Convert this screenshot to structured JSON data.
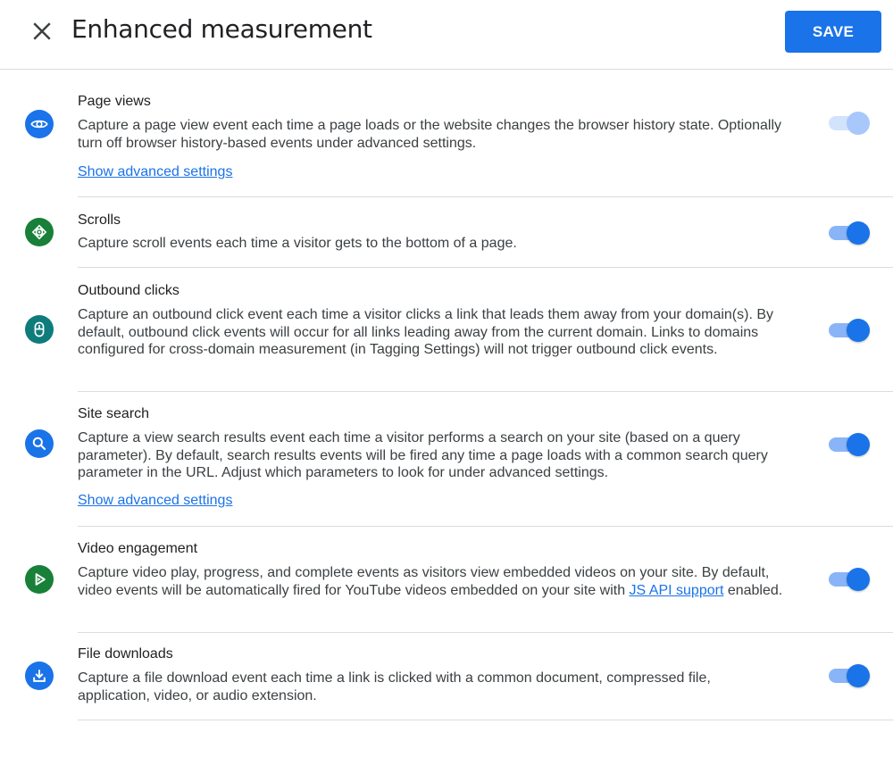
{
  "header": {
    "title": "Enhanced measurement",
    "close_icon": "close-icon",
    "save_label": "SAVE"
  },
  "colors": {
    "primary": "#1a73e8",
    "green": "#188038",
    "teal": "#0f7c7c",
    "divider": "#dadce0"
  },
  "settings": [
    {
      "name": "Page views",
      "icon": "eye-icon",
      "description": "Capture a page view event each time a page loads or the website changes the browser history state. Optionally turn off browser history-based events under advanced settings.",
      "advanced_link": "Show advanced settings",
      "enabled": true,
      "toggle_disabled": true
    },
    {
      "name": "Scrolls",
      "icon": "scroll-icon",
      "description": "Capture scroll events each time a visitor gets to the bottom of a page.",
      "enabled": true,
      "toggle_disabled": false
    },
    {
      "name": "Outbound clicks",
      "icon": "mouse-icon",
      "description": "Capture an outbound click event each time a visitor clicks a link that leads them away from your domain(s). By default, outbound click events will occur for all links leading away from the current domain. Links to domains configured for cross-domain measurement (in Tagging Settings) will not trigger outbound click events.",
      "enabled": true,
      "toggle_disabled": false
    },
    {
      "name": "Site search",
      "icon": "search-icon",
      "description": "Capture a view search results event each time a visitor performs a search on your site (based on a query parameter). By default, search results events will be fired any time a page loads with a common search query parameter in the URL. Adjust which parameters to look for under advanced settings.",
      "advanced_link": "Show advanced settings",
      "enabled": true,
      "toggle_disabled": false
    },
    {
      "name": "Video engagement",
      "icon": "play-icon",
      "description_before": "Capture video play, progress, and complete events as visitors view embedded videos on your site. By default, video events will be automatically fired for YouTube videos embedded on your site with ",
      "description_link": "JS API support",
      "description_after": " enabled.",
      "enabled": true,
      "toggle_disabled": false
    },
    {
      "name": "File downloads",
      "icon": "download-icon",
      "description": "Capture a file download event each time a link is clicked with a common document, compressed file, application, video, or audio extension.",
      "enabled": true,
      "toggle_disabled": false
    }
  ]
}
